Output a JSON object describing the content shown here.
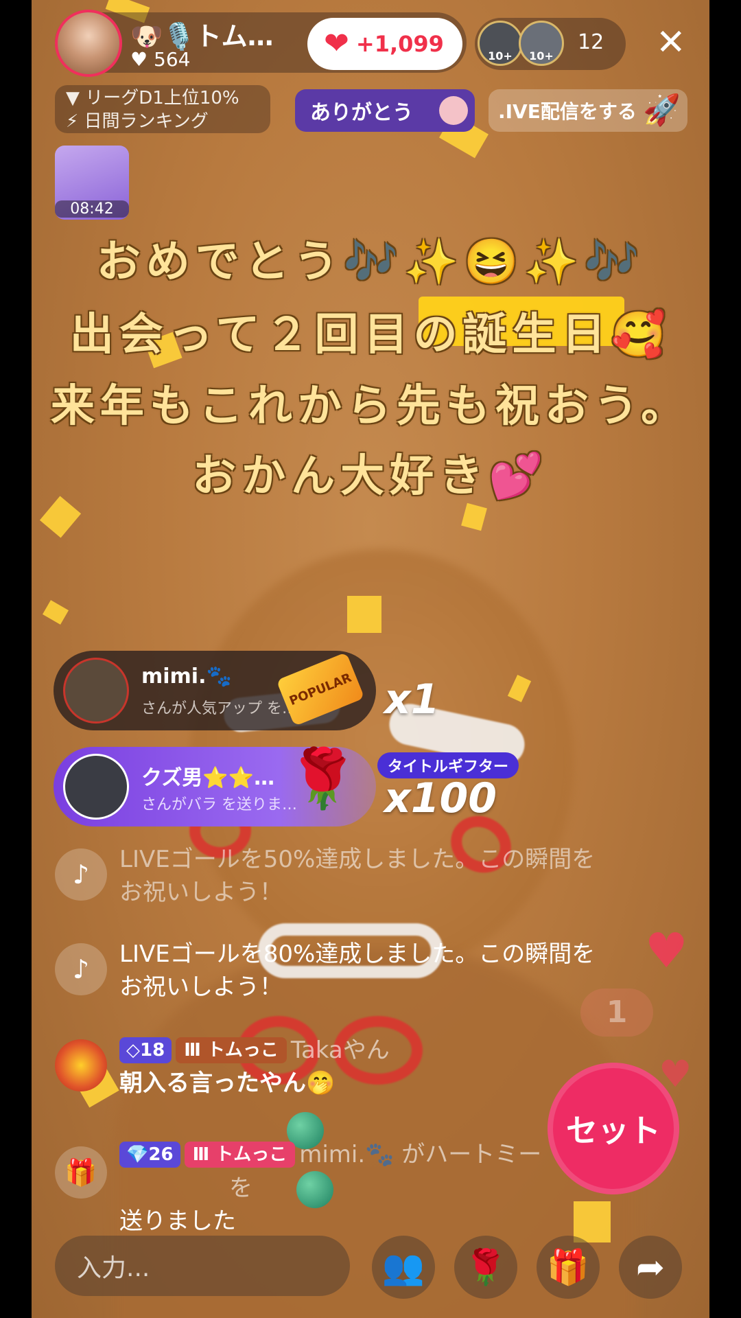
{
  "host": {
    "name": "🐶🎙️トム…",
    "likes": "564"
  },
  "likes_counter": {
    "heart": "❤",
    "value": "+1,099"
  },
  "viewers": {
    "badge1": "10+",
    "badge2": "10+",
    "count": "12"
  },
  "rank_info": {
    "line1": "▼ リーグD1上位10%",
    "line2": "⚡ 日間ランキング"
  },
  "thanks_label": "ありがとう",
  "live_promo": ".IVE配信をする",
  "gift_timer": "08:42",
  "message": {
    "line1": "おめでとう🎶✨😆✨🎶",
    "line2": "出会って２回目の誕生日🥰",
    "line3": "来年もこれから先も祝おう。",
    "line4": "おかん大好き💕"
  },
  "gift_banners": [
    {
      "name": "mimi.🐾",
      "sub": "さんが人気アップ を…",
      "combo": "x1",
      "icon_text": "POPULAR"
    },
    {
      "name": "クズ男⭐⭐…",
      "sub": "さんがバラ を送りま…",
      "combo": "x100",
      "tag": "タイトルギフター"
    }
  ],
  "chat": [
    {
      "icon": "♪",
      "text1": "LIVEゴールを50%達成しました。この瞬間を",
      "text2": "お祝いしよう！"
    },
    {
      "icon": "♪",
      "text1": "LIVEゴールを80%達成しました。この瞬間を",
      "text2": "お祝いしよう！"
    },
    {
      "level": "◇18",
      "fan": "Ⅲ トムっこ",
      "user": "Takaやん",
      "text": "朝入る言ったやん🤭"
    },
    {
      "icon": "🎁",
      "level": "💎26",
      "fan": "Ⅲ トムっこ",
      "user": "mimi.🐾 がハートミー",
      "text_end": "を",
      "text": "送りました"
    }
  ],
  "set_button_label": "セット",
  "float_num": "1",
  "input_placeholder": "入力...",
  "colors": {
    "accent": "#ee2c64",
    "brand_purple": "#5b3aa6",
    "text_gold": "#ffe39a"
  }
}
